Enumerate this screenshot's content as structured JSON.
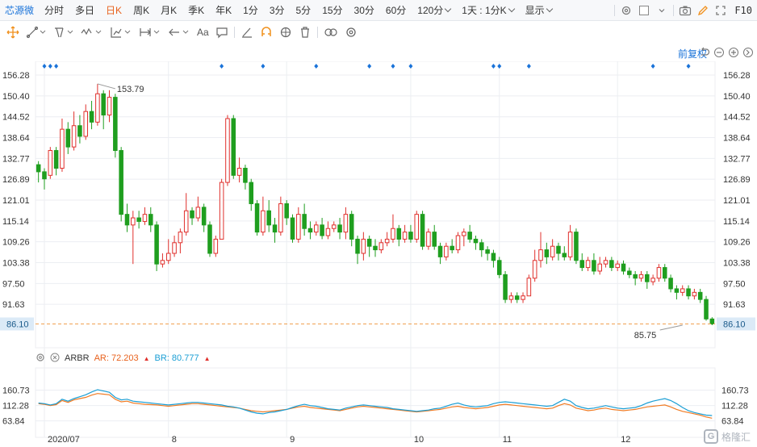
{
  "header": {
    "stock_name": "芯源微",
    "periods": [
      {
        "label": "分时",
        "dropdown": false
      },
      {
        "label": "多日",
        "dropdown": false
      },
      {
        "label": "日K",
        "dropdown": false
      },
      {
        "label": "周K",
        "dropdown": false
      },
      {
        "label": "月K",
        "dropdown": false
      },
      {
        "label": "季K",
        "dropdown": false
      },
      {
        "label": "年K",
        "dropdown": false
      },
      {
        "label": "1分",
        "dropdown": false
      },
      {
        "label": "3分",
        "dropdown": false
      },
      {
        "label": "5分",
        "dropdown": false
      },
      {
        "label": "15分",
        "dropdown": false
      },
      {
        "label": "30分",
        "dropdown": false
      },
      {
        "label": "60分",
        "dropdown": false
      },
      {
        "label": "120分",
        "dropdown": true
      },
      {
        "label": "1天 : 1分K",
        "dropdown": true
      },
      {
        "label": "显示",
        "dropdown": true
      }
    ],
    "active_period": "日K",
    "f10": "F10"
  },
  "drawing_tools": {
    "text_tool": "Aa"
  },
  "adjust_label": "前复权",
  "indicator": {
    "name": "ARBR",
    "ar_label": "AR: 72.203",
    "br_label": "BR: 80.777"
  },
  "watermark": "格隆汇",
  "colors": {
    "up": "#e0302c",
    "down": "#1f9e1f",
    "ar_line": "#f07b24",
    "br_line": "#1a9ed4",
    "current_price": "#f0a050",
    "grid": "#eceef2",
    "axis_text": "#333333",
    "marker": "#1a73d9"
  },
  "chart_data": {
    "type": "candlestick",
    "title": "",
    "price_axis": {
      "ticks": [
        "156.28",
        "150.40",
        "144.52",
        "138.64",
        "132.77",
        "126.89",
        "121.01",
        "115.14",
        "109.26",
        "103.38",
        "97.50",
        "91.63"
      ],
      "ylim": [
        85.75,
        156.28
      ]
    },
    "x_labels": [
      "2020/07",
      "8",
      "9",
      "10",
      "11",
      "12"
    ],
    "x_label_index": [
      1,
      22,
      42,
      63,
      78,
      98
    ],
    "high_annotation": {
      "value": "153.79",
      "index": 10
    },
    "low_annotation": {
      "value": "85.75",
      "index": 109
    },
    "current_price": "86.10",
    "event_marker_index": [
      1,
      2,
      3,
      31,
      38,
      47,
      56,
      60,
      63,
      77,
      78,
      83,
      104,
      110
    ],
    "ohlc": [
      [
        131.0,
        129.0,
        132.0,
        126.0
      ],
      [
        129.0,
        127.0,
        130.0,
        124.0
      ],
      [
        128.0,
        135.0,
        136.0,
        127.0
      ],
      [
        135.0,
        130.0,
        136.0,
        128.0
      ],
      [
        130.0,
        141.0,
        144.0,
        129.0
      ],
      [
        141.0,
        136.0,
        143.0,
        134.0
      ],
      [
        136.0,
        142.0,
        146.0,
        135.0
      ],
      [
        142.0,
        139.0,
        145.0,
        137.0
      ],
      [
        139.0,
        146.0,
        148.0,
        138.0
      ],
      [
        146.0,
        143.0,
        149.0,
        141.0
      ],
      [
        143.0,
        151.0,
        153.79,
        142.0
      ],
      [
        151.0,
        145.0,
        152.0,
        141.0
      ],
      [
        145.0,
        150.0,
        152.0,
        143.0
      ],
      [
        150.0,
        135.0,
        151.0,
        133.0
      ],
      [
        135.0,
        117.0,
        136.0,
        115.0
      ],
      [
        117.0,
        114.0,
        120.0,
        112.0
      ],
      [
        114.0,
        116.0,
        118.0,
        103.0
      ],
      [
        116.0,
        115.0,
        118.0,
        113.0
      ],
      [
        115.0,
        117.0,
        119.0,
        114.0
      ],
      [
        117.0,
        114.0,
        119.0,
        112.0
      ],
      [
        114.0,
        103.0,
        115.0,
        101.0
      ],
      [
        103.0,
        104.0,
        106.0,
        102.0
      ],
      [
        104.0,
        106.0,
        110.0,
        103.0
      ],
      [
        106.0,
        109.0,
        111.0,
        105.0
      ],
      [
        109.0,
        112.0,
        113.0,
        106.0
      ],
      [
        112.0,
        118.0,
        123.0,
        111.0
      ],
      [
        118.0,
        116.0,
        119.0,
        114.0
      ],
      [
        116.0,
        119.0,
        122.0,
        115.0
      ],
      [
        119.0,
        114.0,
        120.0,
        112.0
      ],
      [
        114.0,
        106.0,
        115.0,
        105.0
      ],
      [
        106.0,
        110.0,
        111.0,
        105.0
      ],
      [
        110.0,
        126.0,
        127.0,
        115.0
      ],
      [
        126.0,
        144.0,
        145.0,
        125.0
      ],
      [
        144.0,
        128.0,
        145.0,
        127.0
      ],
      [
        128.0,
        130.0,
        133.0,
        126.0
      ],
      [
        130.0,
        126.0,
        131.0,
        124.0
      ],
      [
        126.0,
        120.0,
        127.0,
        118.0
      ],
      [
        120.0,
        112.0,
        121.0,
        111.0
      ],
      [
        112.0,
        118.0,
        122.0,
        111.0
      ],
      [
        118.0,
        114.0,
        121.0,
        112.0
      ],
      [
        114.0,
        112.0,
        116.0,
        109.0
      ],
      [
        112.0,
        120.0,
        122.0,
        111.0
      ],
      [
        120.0,
        116.0,
        121.0,
        114.0
      ],
      [
        116.0,
        110.0,
        117.0,
        109.0
      ],
      [
        110.0,
        117.0,
        119.0,
        109.0
      ],
      [
        117.0,
        113.0,
        120.0,
        111.0
      ],
      [
        113.0,
        112.0,
        115.0,
        110.0
      ],
      [
        112.0,
        114.0,
        115.0,
        111.0
      ],
      [
        114.0,
        111.0,
        116.0,
        110.0
      ],
      [
        111.0,
        113.0,
        115.0,
        110.0
      ],
      [
        113.0,
        114.0,
        115.0,
        112.0
      ],
      [
        114.0,
        112.0,
        116.0,
        110.0
      ],
      [
        112.0,
        117.0,
        119.0,
        110.0
      ],
      [
        117.0,
        110.0,
        118.0,
        108.0
      ],
      [
        110.0,
        106.0,
        111.0,
        103.0
      ],
      [
        106.0,
        110.0,
        112.0,
        104.0
      ],
      [
        110.0,
        108.0,
        111.0,
        105.0
      ],
      [
        108.0,
        107.0,
        110.0,
        105.0
      ],
      [
        107.0,
        109.0,
        110.0,
        106.0
      ],
      [
        109.0,
        110.0,
        112.0,
        108.0
      ],
      [
        110.0,
        113.0,
        117.0,
        109.0
      ],
      [
        113.0,
        110.0,
        114.0,
        108.0
      ],
      [
        110.0,
        112.0,
        114.0,
        109.0
      ],
      [
        112.0,
        110.0,
        114.0,
        109.0
      ],
      [
        110.0,
        117.0,
        118.0,
        109.0
      ],
      [
        117.0,
        108.0,
        118.0,
        107.0
      ],
      [
        108.0,
        112.0,
        113.0,
        107.0
      ],
      [
        112.0,
        108.0,
        114.0,
        107.0
      ],
      [
        108.0,
        105.0,
        109.0,
        103.0
      ],
      [
        105.0,
        108.0,
        109.0,
        104.0
      ],
      [
        108.0,
        107.0,
        110.0,
        106.0
      ],
      [
        107.0,
        111.0,
        112.0,
        106.0
      ],
      [
        111.0,
        112.0,
        113.0,
        108.0
      ],
      [
        112.0,
        110.0,
        114.0,
        109.0
      ],
      [
        110.0,
        109.0,
        111.0,
        107.0
      ],
      [
        109.0,
        107.0,
        110.0,
        105.0
      ],
      [
        107.0,
        106.0,
        108.0,
        104.0
      ],
      [
        106.0,
        104.0,
        107.0,
        102.0
      ],
      [
        104.0,
        100.0,
        105.0,
        99.0
      ],
      [
        100.0,
        93.0,
        101.0,
        92.0
      ],
      [
        93.0,
        94.0,
        95.0,
        92.0
      ],
      [
        94.0,
        93.0,
        95.0,
        92.0
      ],
      [
        93.0,
        94.0,
        95.0,
        92.0
      ],
      [
        94.0,
        99.0,
        100.0,
        98.0
      ],
      [
        99.0,
        104.0,
        107.0,
        98.0
      ],
      [
        104.0,
        107.0,
        112.0,
        102.0
      ],
      [
        107.0,
        105.0,
        109.0,
        103.0
      ],
      [
        105.0,
        108.0,
        110.0,
        104.0
      ],
      [
        108.0,
        106.0,
        109.0,
        104.0
      ],
      [
        106.0,
        105.0,
        108.0,
        104.0
      ],
      [
        105.0,
        112.0,
        114.0,
        104.0
      ],
      [
        112.0,
        104.0,
        113.0,
        103.0
      ],
      [
        104.0,
        102.0,
        106.0,
        101.0
      ],
      [
        102.0,
        104.0,
        105.0,
        101.0
      ],
      [
        104.0,
        101.0,
        106.0,
        100.0
      ],
      [
        101.0,
        103.0,
        105.0,
        100.0
      ],
      [
        103.0,
        104.0,
        105.0,
        102.0
      ],
      [
        104.0,
        102.0,
        105.0,
        101.0
      ],
      [
        102.0,
        103.0,
        104.0,
        101.0
      ],
      [
        103.0,
        101.0,
        104.0,
        100.0
      ],
      [
        101.0,
        100.0,
        102.0,
        99.0
      ],
      [
        100.0,
        99.0,
        101.0,
        97.0
      ],
      [
        99.0,
        100.0,
        101.0,
        98.0
      ],
      [
        100.0,
        98.0,
        101.0,
        96.0
      ],
      [
        98.0,
        99.0,
        100.0,
        97.0
      ],
      [
        99.0,
        102.0,
        103.0,
        98.0
      ],
      [
        102.0,
        99.0,
        103.0,
        98.0
      ],
      [
        99.0,
        96.0,
        100.0,
        95.0
      ],
      [
        96.0,
        95.0,
        97.0,
        93.0
      ],
      [
        95.0,
        96.0,
        97.0,
        94.0
      ],
      [
        96.0,
        94.0,
        97.0,
        93.0
      ],
      [
        94.0,
        95.0,
        96.0,
        93.0
      ],
      [
        95.0,
        93.0,
        96.0,
        92.0
      ],
      [
        93.0,
        87.5,
        94.0,
        87.0
      ],
      [
        87.5,
        86.1,
        88.0,
        85.75
      ]
    ],
    "indicator": {
      "name": "ARBR",
      "y_ticks": [
        "160.73",
        "112.28",
        "63.84"
      ],
      "ylim": [
        40,
        190
      ],
      "series": [
        {
          "name": "AR",
          "current": "72.203",
          "values": [
            118,
            116,
            112,
            115,
            128,
            122,
            130,
            134,
            138,
            145,
            150,
            148,
            146,
            132,
            124,
            126,
            120,
            118,
            116,
            115,
            114,
            112,
            110,
            112,
            114,
            116,
            118,
            118,
            116,
            114,
            112,
            110,
            108,
            106,
            104,
            100,
            96,
            94,
            92,
            94,
            96,
            98,
            100,
            104,
            108,
            110,
            106,
            104,
            102,
            100,
            98,
            96,
            100,
            104,
            108,
            110,
            108,
            106,
            104,
            102,
            100,
            98,
            96,
            94,
            92,
            94,
            96,
            98,
            100,
            104,
            108,
            110,
            106,
            104,
            102,
            104,
            106,
            110,
            114,
            116,
            114,
            112,
            110,
            108,
            106,
            104,
            102,
            104,
            112,
            118,
            114,
            104,
            100,
            96,
            98,
            102,
            104,
            100,
            98,
            96,
            98,
            100,
            104,
            108,
            110,
            112,
            114,
            108,
            100,
            94,
            90,
            86,
            82,
            76,
            72.203
          ]
        },
        {
          "name": "BR",
          "current": "80.777",
          "values": [
            120,
            118,
            114,
            118,
            132,
            126,
            134,
            140,
            146,
            155,
            162,
            158,
            154,
            138,
            130,
            132,
            126,
            124,
            122,
            120,
            118,
            116,
            114,
            116,
            118,
            120,
            122,
            122,
            120,
            118,
            116,
            114,
            110,
            108,
            104,
            98,
            92,
            88,
            86,
            90,
            92,
            96,
            100,
            106,
            112,
            116,
            112,
            110,
            106,
            102,
            100,
            98,
            104,
            108,
            112,
            114,
            112,
            110,
            108,
            106,
            102,
            100,
            98,
            96,
            94,
            96,
            98,
            102,
            104,
            110,
            116,
            120,
            114,
            110,
            108,
            110,
            112,
            118,
            122,
            124,
            122,
            120,
            118,
            116,
            114,
            112,
            110,
            112,
            122,
            132,
            126,
            112,
            106,
            102,
            104,
            108,
            112,
            108,
            104,
            102,
            104,
            106,
            112,
            120,
            126,
            130,
            134,
            128,
            118,
            106,
            96,
            90,
            86,
            82,
            80.777
          ]
        }
      ]
    }
  }
}
